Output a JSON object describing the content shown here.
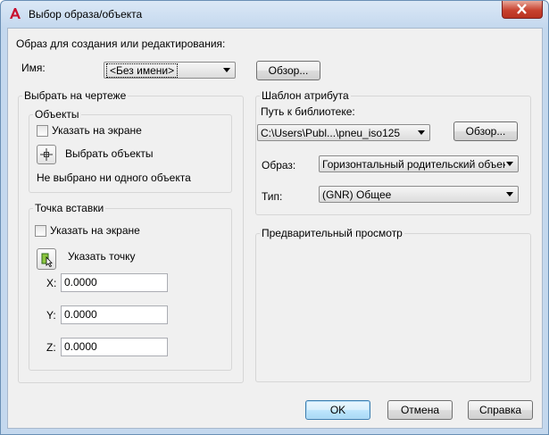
{
  "window": {
    "title": "Выбор образа/объекта"
  },
  "header": {
    "prompt": "Образ для создания или редактирования:",
    "name_label": "Имя:",
    "name_value": "<Без имени>",
    "browse_label": "Обзор..."
  },
  "select_on_drawing": {
    "title": "Выбрать на чертеже",
    "objects": {
      "title": "Объекты",
      "specify_on_screen": "Указать на экране",
      "specify_checked": false,
      "select_objects": "Выбрать объекты",
      "status": "Не выбрано ни одного объекта"
    },
    "insertion_point": {
      "title": "Точка вставки",
      "specify_on_screen": "Указать на экране",
      "specify_checked": false,
      "pick_point": "Указать точку",
      "x_label": "X:",
      "x_value": "0.0000",
      "y_label": "Y:",
      "y_value": "0.0000",
      "z_label": "Z:",
      "z_value": "0.0000"
    }
  },
  "attribute_template": {
    "title": "Шаблон атрибута",
    "library_path_label": "Путь к библиотеке:",
    "library_path_value": "C:\\Users\\Publ...\\pneu_iso125",
    "browse_label": "Обзор...",
    "image_label": "Образ:",
    "image_value": "Горизонтальный родительский объект",
    "type_label": "Тип:",
    "type_value": "(GNR) Общее"
  },
  "preview": {
    "title": "Предварительный просмотр"
  },
  "footer": {
    "ok": "OK",
    "cancel": "Отмена",
    "help": "Справка"
  },
  "colors": {
    "title_gradient_top": "#dbe8f6",
    "frame_blue": "#c4d8ee",
    "dialog_bg": "#f0f0f0",
    "close_red": "#c8422f",
    "default_button_blue": "#bee6fd",
    "app_icon_red": "#c8102e"
  }
}
